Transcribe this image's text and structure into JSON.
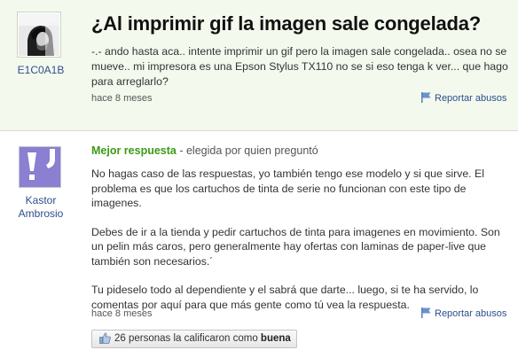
{
  "question": {
    "user_name": "E1C0A1B",
    "title": "¿Al imprimir gif la imagen sale congelada?",
    "body": "-.- ando hasta aca.. intente imprimir un gif pero la imagen sale congelada.. osea no se mueve.. mi impresora es una Epson Stylus TX110 no se si eso tenga k ver... que hago para arreglarlo?",
    "time": "hace 8 meses",
    "report_label": "Reportar abusos"
  },
  "answer": {
    "user_name_line1": "Kastor",
    "user_name_line2": "Ambrosio",
    "best_label": "Mejor respuesta",
    "best_suffix": " - elegida por quien preguntó",
    "paragraphs": [
      "No hagas caso de las respuestas, yo también tengo ese modelo y si que sirve. El problema es que los cartuchos de tinta de serie no funcionan con este tipo de imagenes.",
      "Debes de ir a la tienda y pedir cartuchos de tinta para imagenes en movimiento. Son un pelin más caros, pero generalmente hay ofertas con laminas de paper-live que también son necesarios.´",
      "Tu pideselo todo al dependiente y el sabrá que darte... luego, si te ha servido, lo comentas por aquí para que más gente como tú vea la respuesta."
    ],
    "time": "hace 8 meses",
    "report_label": "Reportar abusos",
    "rating_text": "26 personas la calificaron como ",
    "rating_value": "buena"
  },
  "colors": {
    "question_bg": "#f4f9ee",
    "link": "#2b4f8c",
    "best_green": "#3c9a16",
    "avatar_purple": "#8a7fd0"
  },
  "icons": {
    "report": "flag-icon",
    "rating": "thumbs-up-icon",
    "answer_avatar": "exclamation-avatar-icon"
  }
}
